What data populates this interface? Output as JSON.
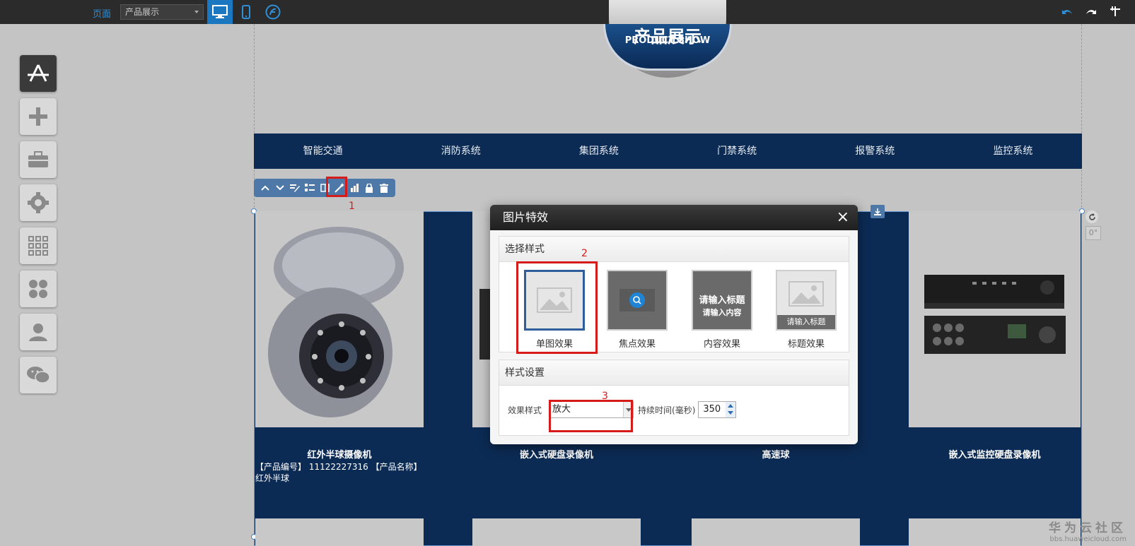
{
  "topbar": {
    "page_label": "页面",
    "page_select_value": "产品展示"
  },
  "left_tools": [
    {
      "icon": "app-store-icon"
    },
    {
      "icon": "plus-icon"
    },
    {
      "icon": "toolbox-icon"
    },
    {
      "icon": "gear-icon"
    },
    {
      "icon": "grid-icon"
    },
    {
      "icon": "modules-icon"
    },
    {
      "icon": "user-icon"
    },
    {
      "icon": "wechat-icon"
    }
  ],
  "logo": {
    "cn": "产品展示",
    "en": "PRODUCT SHOW"
  },
  "nav": [
    "智能交通",
    "消防系统",
    "集团系统",
    "门禁系统",
    "报警系统",
    "监控系统"
  ],
  "annotations": {
    "step1": "1",
    "step2": "2",
    "step3": "3"
  },
  "products": [
    {
      "title": "红外半球摄像机",
      "desc": "【产品编号】 11122227316 【产品名称】 红外半球"
    },
    {
      "title": "嵌入式硬盘录像机",
      "desc": ""
    },
    {
      "title": "高速球",
      "desc": ""
    },
    {
      "title": "嵌入式监控硬盘录像机",
      "desc": ""
    }
  ],
  "rotate": {
    "degree": "0°"
  },
  "dialog": {
    "title": "图片特效",
    "close": "×",
    "section_style": "选择样式",
    "styles": [
      {
        "label": "单图效果"
      },
      {
        "label": "焦点效果"
      },
      {
        "label": "内容效果",
        "thumb_title": "请输入标题",
        "thumb_content": "请输入内容"
      },
      {
        "label": "标题效果",
        "thumb_bar": "请输入标题"
      }
    ],
    "section_settings": "样式设置",
    "effect_label": "效果样式",
    "effect_value": "放大",
    "duration_label": "持续时间(毫秒)",
    "duration_value": "350"
  },
  "watermark": {
    "cn": "华为云社区",
    "url": "bbs.huaweicloud.com"
  },
  "colors": {
    "accent": "#1b78c0",
    "nav_bg": "#0c2b54",
    "highlight_red": "#d61b1b"
  }
}
